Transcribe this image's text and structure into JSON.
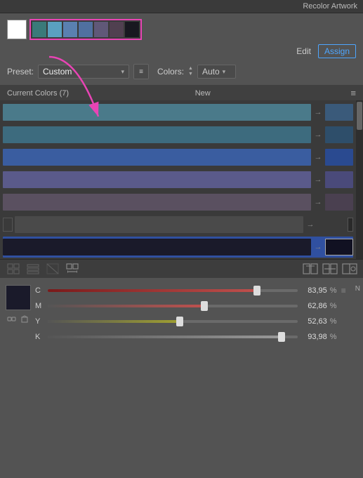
{
  "title": "Recolor Artwork",
  "tabs": {
    "edit": "Edit",
    "assign": "Assign"
  },
  "preset": {
    "label": "Preset:",
    "value": "Custom",
    "placeholder": "Custom"
  },
  "colors": {
    "label": "Colors:",
    "value": "Auto"
  },
  "currentColors": {
    "label": "Current Colors (7)",
    "newLabel": "New"
  },
  "colorRows": [
    {
      "mainColor": "#4a7a8a",
      "newColor": "#3a5a7a",
      "arrow": "→"
    },
    {
      "mainColor": "#3d6b7e",
      "newColor": "#2e4e6a",
      "arrow": "→"
    },
    {
      "mainColor": "#3a5da0",
      "newColor": "#2a4a90",
      "arrow": "→"
    },
    {
      "mainColor": "#5a5a8a",
      "newColor": "#4a4a7a",
      "arrow": "→"
    },
    {
      "mainColor": "#5a5060",
      "newColor": "#4a4050",
      "arrow": "→"
    },
    {
      "mainColor": "#4a4a4a",
      "newColor": "#3a3a3a",
      "arrow": "→",
      "hasLeftSwatch": true
    },
    {
      "mainColor": "#1a1a2a",
      "newColor": "#111122",
      "arrow": "→",
      "selected": true
    }
  ],
  "cmyk": {
    "c": {
      "label": "C",
      "value": "83,95",
      "pct": "%",
      "fillPct": 84
    },
    "m": {
      "label": "M",
      "value": "62,86",
      "pct": "%",
      "fillPct": 63
    },
    "y": {
      "label": "Y",
      "value": "52,63",
      "pct": "%",
      "fillPct": 53
    },
    "k": {
      "label": "K",
      "value": "93,98",
      "pct": "%",
      "fillPct": 94
    }
  },
  "swatches": [
    {
      "color": "#3a7a7a"
    },
    {
      "color": "#5aa0c0"
    },
    {
      "color": "#5a80b0"
    },
    {
      "color": "#5070a0"
    },
    {
      "color": "#605878"
    },
    {
      "color": "#504050"
    },
    {
      "color": "#181820"
    }
  ],
  "icons": {
    "preset_list": "≡",
    "dropdown_arrow": "▾",
    "stepper_up": "▲",
    "stepper_down": "▼",
    "menu": "≡",
    "arrow_right": "→",
    "toolbar_grid1": "⊞",
    "toolbar_grid2": "⊟",
    "toolbar_no": "⊘",
    "toolbar_move": "⊕",
    "toolbar_r1": "⊞",
    "toolbar_r2": "⊟",
    "toolbar_r3": "⊡"
  }
}
